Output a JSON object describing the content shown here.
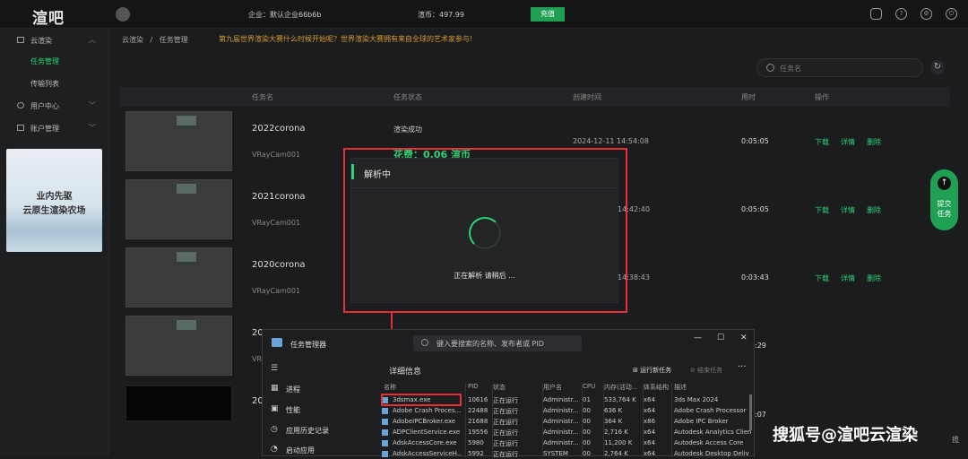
{
  "topbar": {
    "logo": "渲吧",
    "company": "企业：默认企业66b6b",
    "coins": "渲币：497.99",
    "recharge": "充值"
  },
  "sidebar": {
    "cloud_render": "云渲染",
    "task_manage": "任务管理",
    "transfer_list": "传输列表",
    "user_center": "用户中心",
    "account_manage": "账户管理",
    "banner_line1": "业内先驱",
    "banner_line2": "云原生渲染农场"
  },
  "breadcrumb": {
    "root": "云渲染",
    "sep": "/",
    "current": "任务管理"
  },
  "notice": "第九届世界渲染大赛什么时候开始呢？世界渲染大赛拥有来自全球的艺术家参与!",
  "search": {
    "placeholder": "任务名"
  },
  "table": {
    "headers": {
      "name": "任务名",
      "status": "任务状态",
      "created": "创建时间",
      "duration": "用时",
      "actions": "操作"
    },
    "rows": [
      {
        "name": "2022corona",
        "camera": "VRayCam001",
        "status": "渲染成功",
        "cost": "花费：0.06 渲币",
        "created": "2024-12-11 14:54:08",
        "duration": "0:05:05"
      },
      {
        "name": "2021corona",
        "camera": "VRayCam001",
        "created": "14:42:40",
        "duration": "0:05:05"
      },
      {
        "name": "2020corona",
        "camera": "VRayCam001",
        "created": "14:38:43",
        "duration": "0:03:43"
      },
      {
        "name": "20",
        "camera": "VR",
        "duration": ":29"
      },
      {
        "name": "20",
        "duration": ":07"
      }
    ],
    "actions": {
      "download": "下载",
      "detail": "详情",
      "delete": "删除"
    }
  },
  "submit": {
    "line1": "提交",
    "line2": "任务",
    "arrow": "↑"
  },
  "modal": {
    "title": "解析中",
    "message": "正在解析 请稍后 ..."
  },
  "task_manager": {
    "title": "任务管理器",
    "search_placeholder": "键入要搜索的名称、发布者或 PID",
    "heading": "详细信息",
    "run_new": "运行新任务",
    "end_task": "结束任务",
    "nav": [
      "进程",
      "性能",
      "应用历史记录",
      "启动应用"
    ],
    "columns": [
      "名称",
      "PID",
      "状态",
      "用户名",
      "CPU",
      "内存(活动...",
      "体系结构",
      "描述"
    ],
    "rows": [
      [
        "3dsmax.exe",
        "10616",
        "正在运行",
        "Administr...",
        "01",
        "533,764 K",
        "x64",
        "3ds Max 2024"
      ],
      [
        "Adobe Crash Proces...",
        "22488",
        "正在运行",
        "Administr...",
        "00",
        "636 K",
        "x64",
        "Adobe Crash Processor"
      ],
      [
        "AdobeIPCBroker.exe",
        "21688",
        "正在运行",
        "Administr...",
        "00",
        "364 K",
        "x86",
        "Adobe IPC Broker"
      ],
      [
        "ADPClientService.exe",
        "19556",
        "正在运行",
        "Administr...",
        "00",
        "2,716 K",
        "x64",
        "Autodesk Analytics Clien"
      ],
      [
        "AdskAccessCore.exe",
        "5980",
        "正在运行",
        "Administr...",
        "00",
        "11,200 K",
        "x64",
        "Autodesk Access Core"
      ],
      [
        "AdskAccessServiceH...",
        "5992",
        "正在运行",
        "SYSTEM",
        "00",
        "2,764 K",
        "x64",
        "Autodesk Desktop Deliv"
      ]
    ]
  },
  "watermark": "搜狐号@渲吧云渲染",
  "edge_text": "揽",
  "colors": {
    "accent": "#2fd174",
    "highlight": "#e5303a",
    "warning": "#d79b2e"
  }
}
